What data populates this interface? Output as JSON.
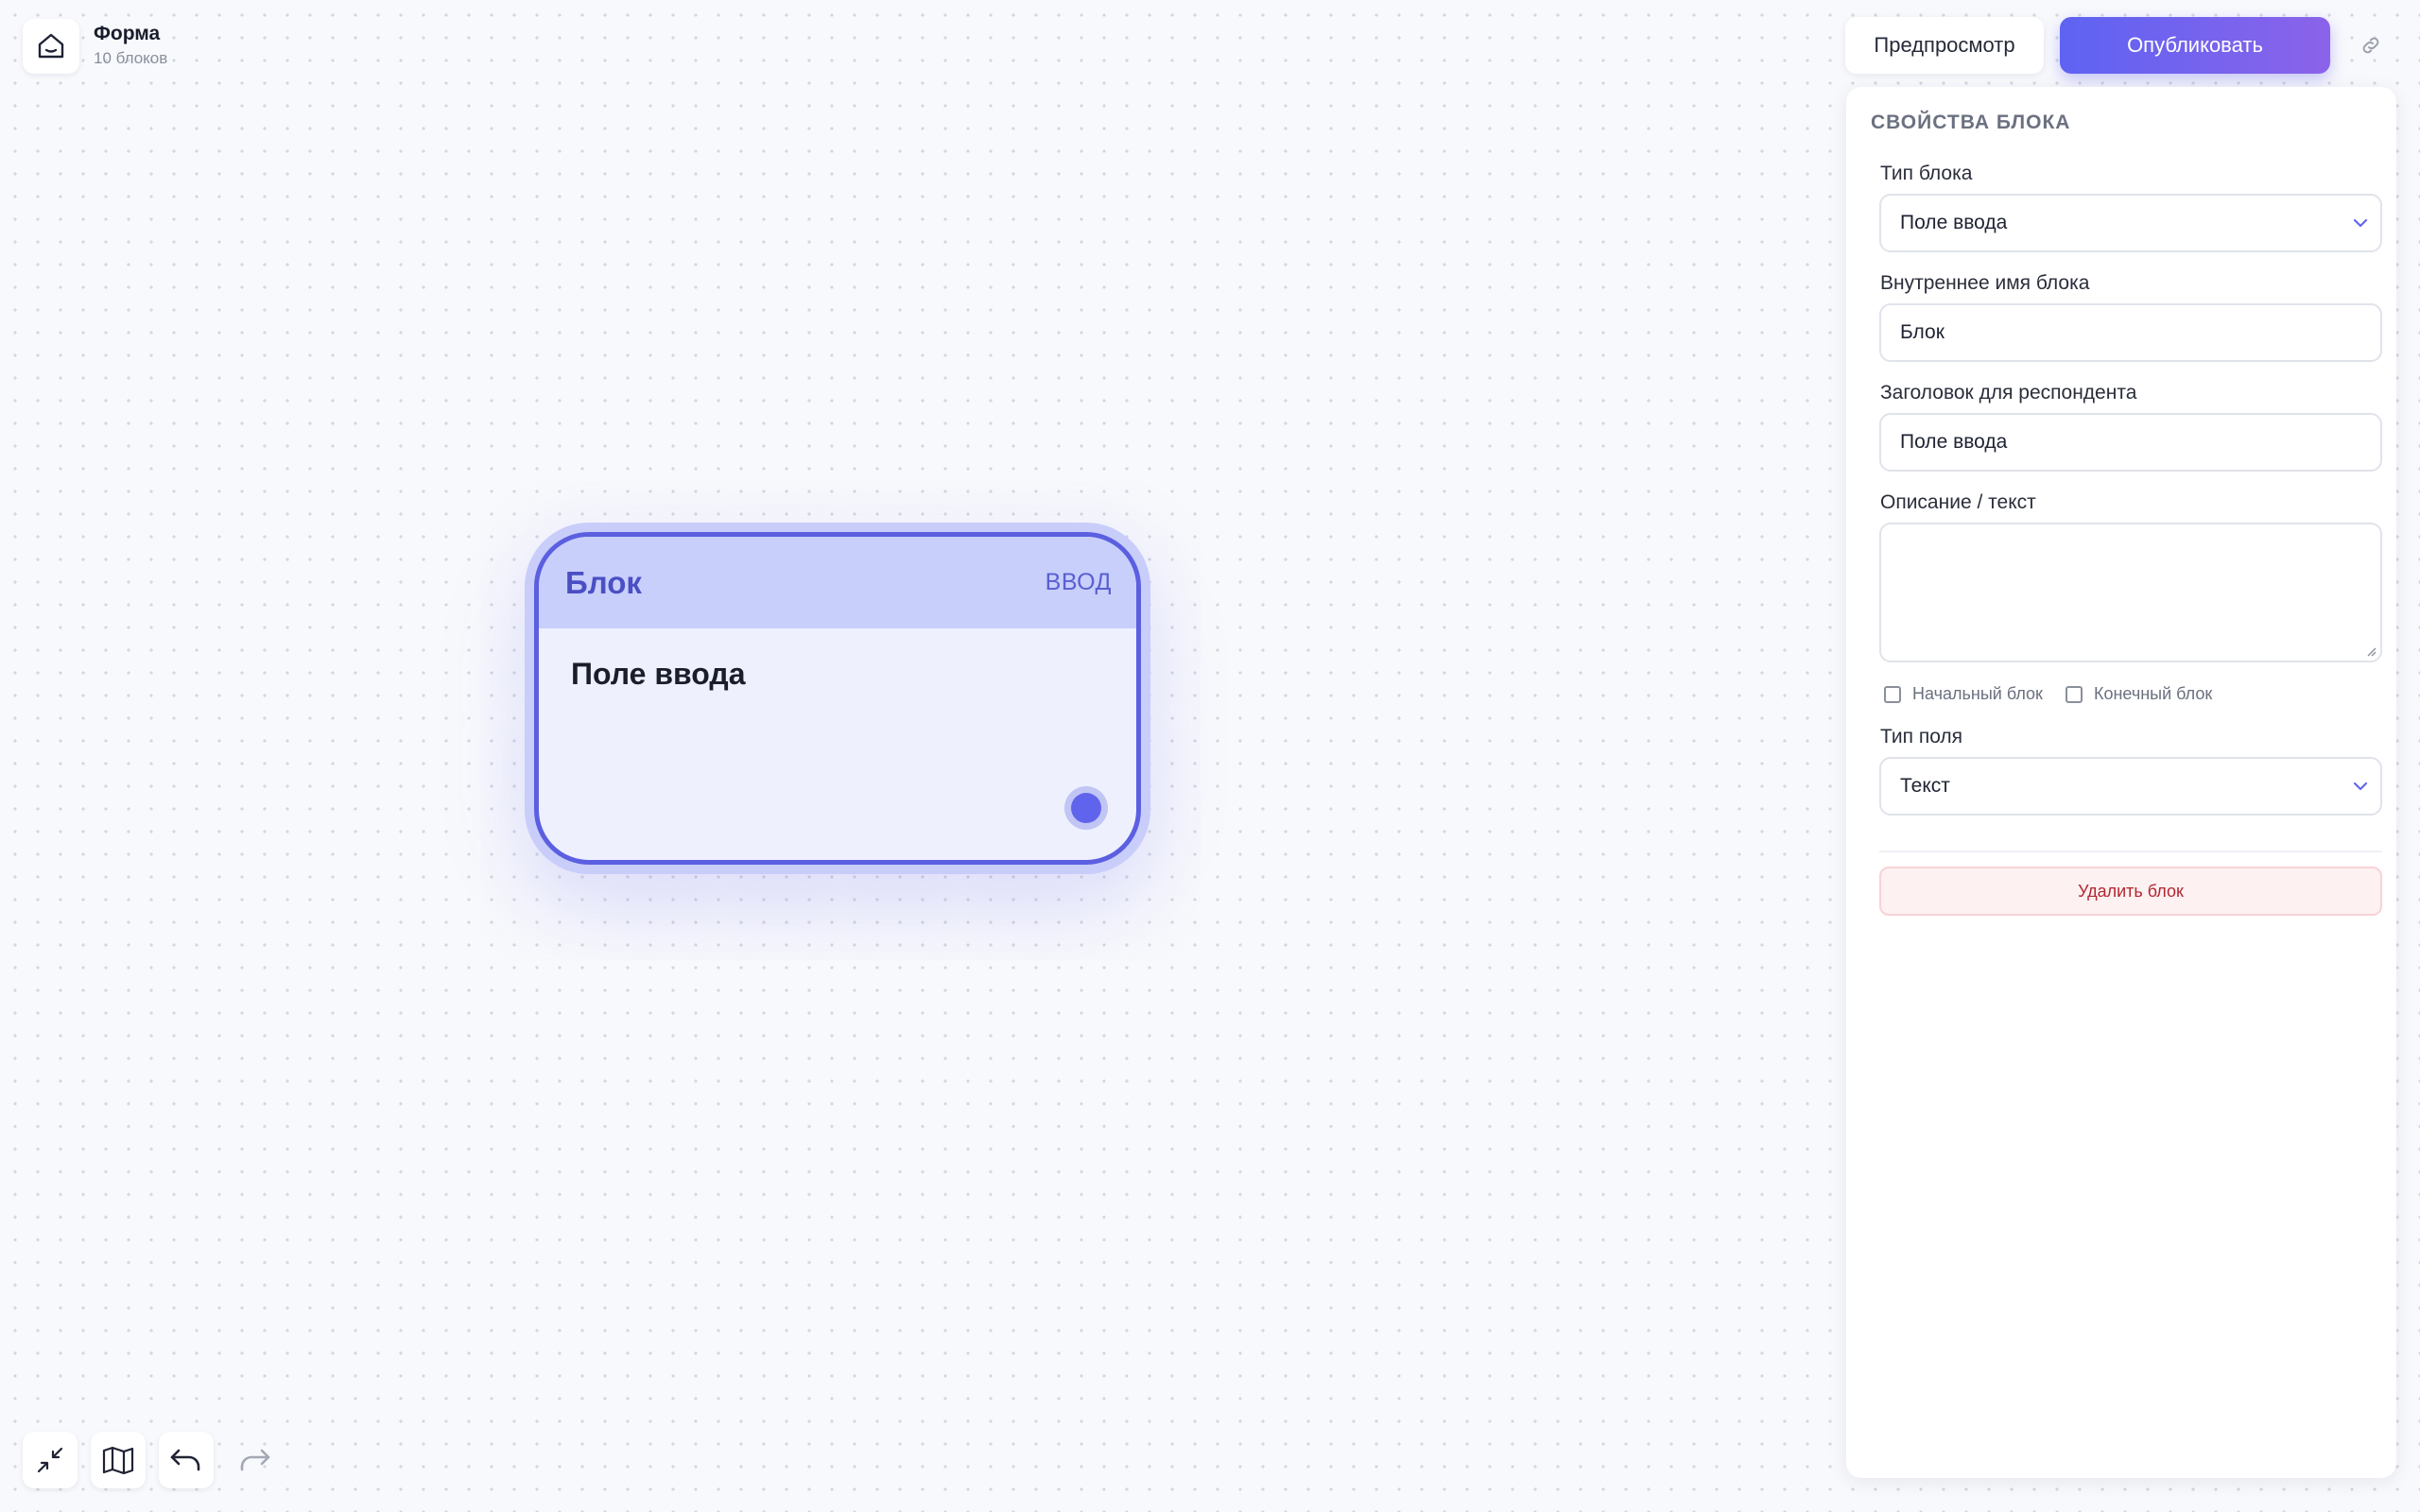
{
  "header": {
    "title": "Форма",
    "subtitle": "10 блоков",
    "home_icon": "home-icon"
  },
  "actions": {
    "preview_label": "Предпросмотр",
    "publish_label": "Опубликовать",
    "link_icon": "link-icon",
    "accent_color": "#6366f1"
  },
  "node": {
    "name": "Блок",
    "type_badge": "ВВОД",
    "body_text": "Поле ввода"
  },
  "panel": {
    "title": "СВОЙСТВА БЛОКА",
    "block_type": {
      "label": "Тип блока",
      "value": "Поле ввода"
    },
    "internal_name": {
      "label": "Внутреннее имя блока",
      "value": "Блок"
    },
    "respondent_title": {
      "label": "Заголовок для респондента",
      "value": "Поле ввода"
    },
    "description": {
      "label": "Описание / текст",
      "value": ""
    },
    "start_block": {
      "label": "Начальный блок",
      "checked": false
    },
    "end_block": {
      "label": "Конечный блок",
      "checked": false
    },
    "field_type": {
      "label": "Тип поля",
      "value": "Текст"
    },
    "delete_label": "Удалить блок"
  },
  "tools": [
    "fit-view-icon",
    "map-icon",
    "undo-icon",
    "redo-icon"
  ]
}
